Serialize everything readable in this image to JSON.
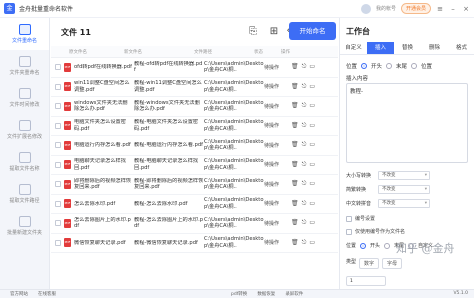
{
  "app": {
    "title": "金舟批量重命名软件",
    "user": "我的帐号",
    "vip": "开通会员"
  },
  "sidebar": {
    "items": [
      {
        "label": "文件重命名",
        "active": true
      },
      {
        "label": "文件夹重命名"
      },
      {
        "label": "文件时间修改"
      },
      {
        "label": "文件扩展名修改"
      },
      {
        "label": "提取文件名称"
      },
      {
        "label": "提取文件路径"
      },
      {
        "label": "批量新建文件夹"
      }
    ]
  },
  "filelist": {
    "count_label": "文件 11",
    "start_button": "开始命名",
    "headers": {
      "name": "原文件名",
      "new": "新文件名",
      "path": "文件路径",
      "status": "状态",
      "ops": "操作"
    },
    "rows": [
      {
        "name": "ofd转pdf在线转换器.pdf",
        "new": "教程-ofd转pdf在线转换器.pdf",
        "path": "C:\\Users\\admin\\Desktop\\金舟CA\\桐..",
        "status": "待操作"
      },
      {
        "name": "win11调整C盘空间怎么调整.pdf",
        "new": "教程-win11调整C盘空间怎么调整.pdf",
        "path": "C:\\Users\\admin\\Desktop\\金舟CA\\桐..",
        "status": "待操作"
      },
      {
        "name": "windows文件夹无法删除怎么办.pdf",
        "new": "教程-windows文件夹无法删除怎么办.pdf",
        "path": "C:\\Users\\admin\\Desktop\\金舟CA\\桐..",
        "status": "待操作"
      },
      {
        "name": "电脑文件夹怎么设置密码.pdf",
        "new": "教程-电脑文件夹怎么设置密码.pdf",
        "path": "C:\\Users\\admin\\Desktop\\金舟CA\\桐..",
        "status": "待操作"
      },
      {
        "name": "电脑运行内存怎么看.pdf",
        "new": "教程-电脑运行内存怎么看.pdf",
        "path": "C:\\Users\\admin\\Desktop\\金舟CA\\桐..",
        "status": "待操作"
      },
      {
        "name": "电脑聊天记录怎么样找回.pdf",
        "new": "教程-电脑聊天记录怎么样找回.pdf",
        "path": "C:\\Users\\admin\\Desktop\\金舟CA\\桐..",
        "status": "待操作"
      },
      {
        "name": "即将删除后的视频怎样恢复回来.pdf",
        "new": "教程-即将删除后的视频怎样恢复回来.pdf",
        "path": "C:\\Users\\admin\\Desktop\\金舟CA\\桐..",
        "status": "待操作"
      },
      {
        "name": "怎么去除水印.pdf",
        "new": "教程-怎么去除水印.pdf",
        "path": "C:\\Users\\admin\\Desktop\\金舟CA\\桐..",
        "status": "待操作"
      },
      {
        "name": "怎么去除图片上的水印.pdf",
        "new": "教程-怎么去除图片上的水印.pdf",
        "path": "C:\\Users\\admin\\Desktop\\金舟CA\\桐..",
        "status": "待操作"
      },
      {
        "name": "微信恢复聊天记录.pdf",
        "new": "教程-微信恢复聊天记录.pdf",
        "path": "C:\\Users\\admin\\Desktop\\金舟CA\\桐..",
        "status": "待操作"
      }
    ]
  },
  "panel": {
    "title": "工作台",
    "tabs": [
      "自定义",
      "插入",
      "替换",
      "删除",
      "格式"
    ],
    "active_tab": "插入",
    "position_label": "位置",
    "position_options": [
      "开头",
      "末尾",
      "位置"
    ],
    "insert_label": "插入内容",
    "insert_value": "教程-",
    "case_label": "大小写转换",
    "case_value": "不改变",
    "fullhalf_label": "简繁转换",
    "fullhalf_value": "不改变",
    "pinyin_label": "中文转拼音",
    "pinyin_value": "不改变",
    "number_label": "编号设置",
    "only_label": "仅使用编号作为文件名",
    "pos2_label": "位置",
    "pos2_options": [
      "开头",
      "末尾",
      "自定义"
    ],
    "type_label": "类型",
    "type_options": [
      "数字",
      "字母"
    ],
    "start_label": "起始",
    "start_value": "1"
  },
  "footer": {
    "website": "官方网站",
    "service": "在线客服",
    "pdf": "pdf转换",
    "data": "数据恢复",
    "screen": "录屏软件",
    "version": "V5.1.0"
  },
  "watermark": "知乎 @金舟"
}
